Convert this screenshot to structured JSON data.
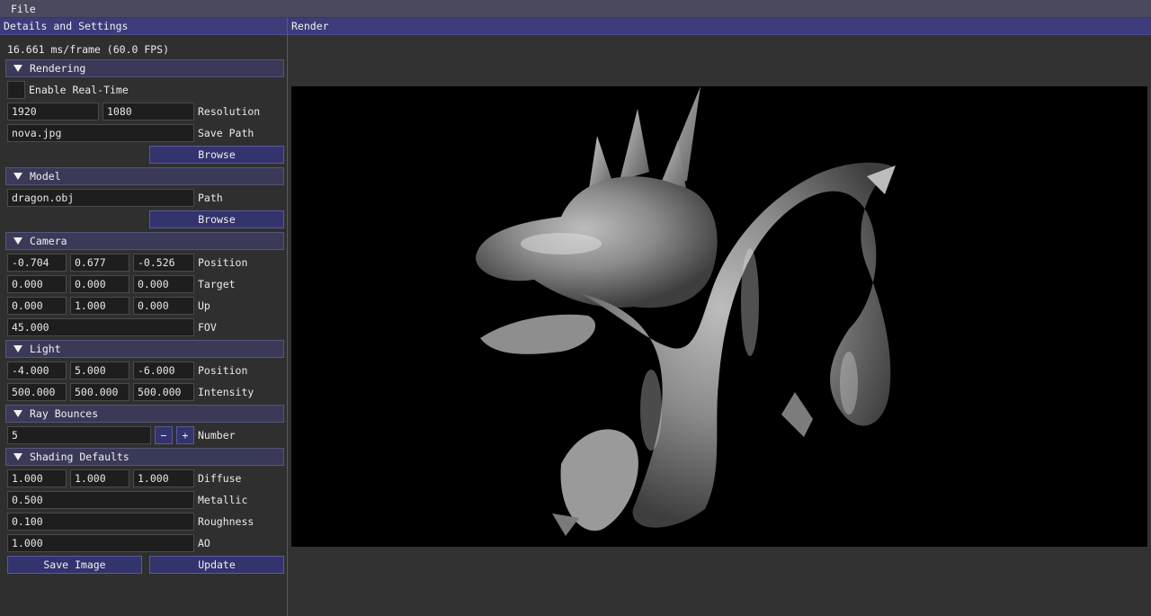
{
  "menu": {
    "file": "File"
  },
  "panel": {
    "title": "Details and Settings",
    "frame_stats": "16.661 ms/frame (60.0 FPS)",
    "rendering": {
      "header": "Rendering",
      "realtime_label": "Enable Real-Time",
      "realtime_checked": false,
      "width": "1920",
      "height": "1080",
      "resolution_label": "Resolution",
      "save_path": "nova.jpg",
      "save_path_label": "Save Path",
      "browse": "Browse"
    },
    "model": {
      "header": "Model",
      "path": "dragon.obj",
      "path_label": "Path",
      "browse": "Browse"
    },
    "camera": {
      "header": "Camera",
      "position": [
        "-0.704",
        "0.677",
        "-0.526"
      ],
      "position_label": "Position",
      "target": [
        "0.000",
        "0.000",
        "0.000"
      ],
      "target_label": "Target",
      "up": [
        "0.000",
        "1.000",
        "0.000"
      ],
      "up_label": "Up",
      "fov": "45.000",
      "fov_label": "FOV"
    },
    "light": {
      "header": "Light",
      "position": [
        "-4.000",
        "5.000",
        "-6.000"
      ],
      "position_label": "Position",
      "intensity": [
        "500.000",
        "500.000",
        "500.000"
      ],
      "intensity_label": "Intensity"
    },
    "bounces": {
      "header": "Ray Bounces",
      "value": "5",
      "minus": "−",
      "plus": "+",
      "label": "Number"
    },
    "shading": {
      "header": "Shading Defaults",
      "diffuse": [
        "1.000",
        "1.000",
        "1.000"
      ],
      "diffuse_label": "Diffuse",
      "metallic": "0.500",
      "metallic_label": "Metallic",
      "roughness": "0.100",
      "roughness_label": "Roughness",
      "ao": "1.000",
      "ao_label": "AO"
    },
    "save_image": "Save Image",
    "update": "Update"
  },
  "render": {
    "title": "Render"
  },
  "colors": {
    "title_bar": "#3c3c7a",
    "button": "#33336e",
    "header": "#3a3a58"
  }
}
